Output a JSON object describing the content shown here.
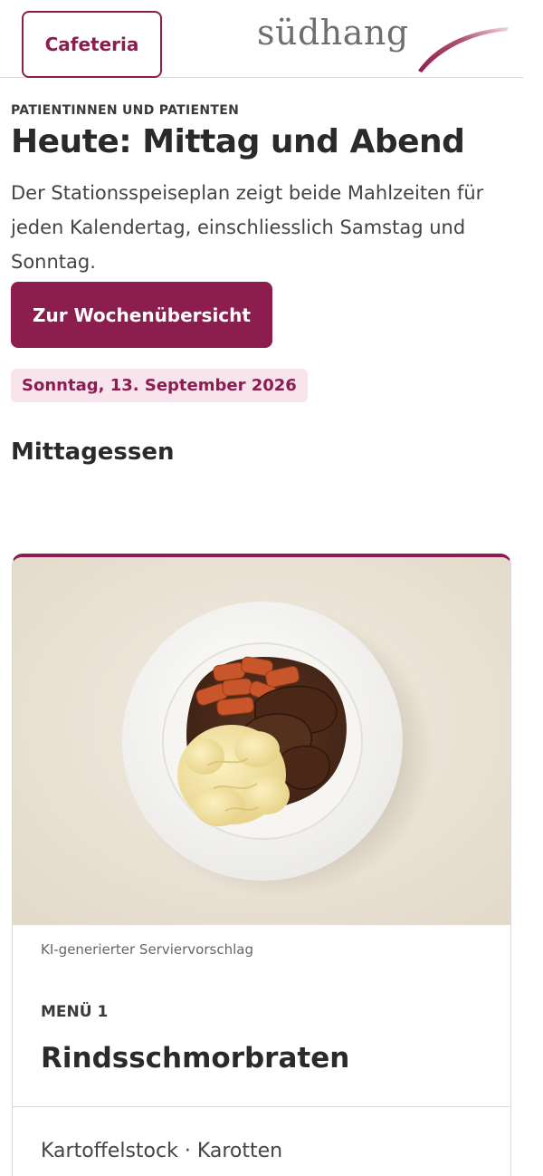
{
  "header": {
    "cafeteria_label": "Cafeteria",
    "logo_text": "südhang"
  },
  "intro": {
    "eyebrow": "PATIENTINNEN UND PATIENTEN",
    "title": "Heute: Mittag und Abend",
    "text": "Der Stationsspeiseplan zeigt beide Mahlzeiten für jeden Kalendertag, einschliesslich Samstag und Sonntag.",
    "week_button": "Zur Wochenübersicht",
    "date": "Sonntag, 13. September 2026"
  },
  "lunch": {
    "section_title": "Mittagessen",
    "card": {
      "image_caption": "KI-generierter Serviervorschlag",
      "menu_label": "MENÜ 1",
      "dish": "Rindsschmorbraten",
      "sides": "Kartoffelstock · Karotten"
    }
  },
  "colors": {
    "accent": "#8c1d4f",
    "badge_bg": "#f7e4ec",
    "text": "#2b2b2b"
  }
}
